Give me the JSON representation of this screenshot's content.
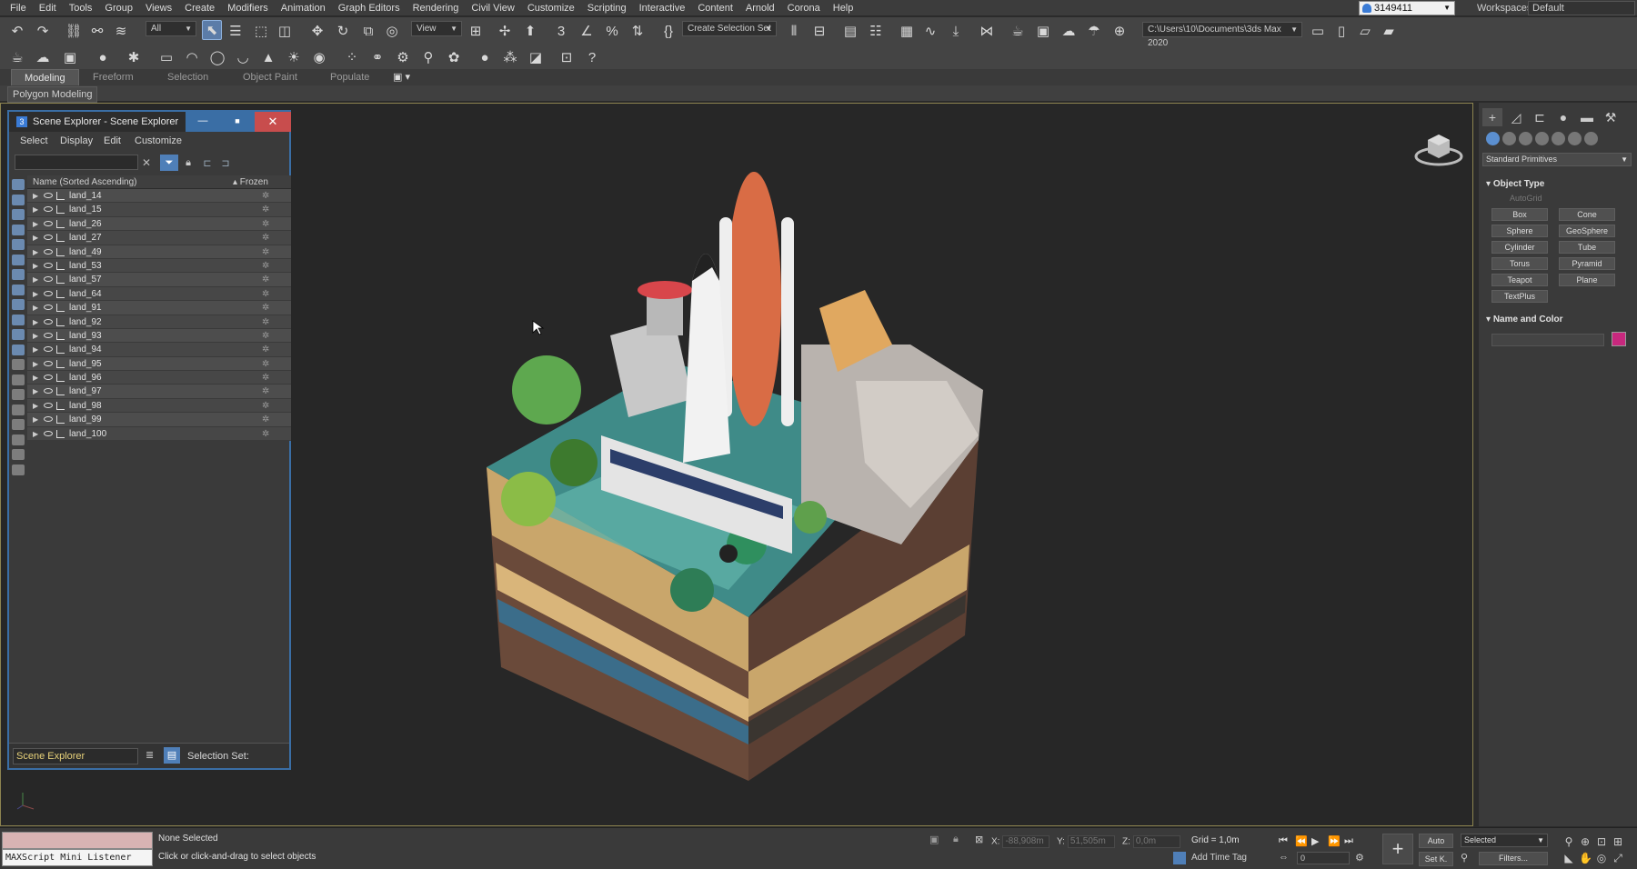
{
  "menu": [
    "File",
    "Edit",
    "Tools",
    "Group",
    "Views",
    "Create",
    "Modifiers",
    "Animation",
    "Graph Editors",
    "Rendering",
    "Civil View",
    "Customize",
    "Scripting",
    "Interactive",
    "Content",
    "Arnold",
    "Corona",
    "Help"
  ],
  "user": {
    "name": "3149411"
  },
  "workspaces": {
    "label": "Workspaces:",
    "value": "Default"
  },
  "toolbar": {
    "filter_value": "All",
    "view_value": "View",
    "selection_set": "Create Selection Set",
    "project_path": "C:\\Users\\10\\Documents\\3ds Max 2020"
  },
  "ribbon": {
    "tabs": [
      "Modeling",
      "Freeform",
      "Selection",
      "Object Paint",
      "Populate"
    ],
    "active": "Modeling",
    "sub_label": "Polygon Modeling"
  },
  "scene_explorer": {
    "title": "Scene Explorer - Scene Explorer",
    "menu": [
      "Select",
      "Display",
      "Edit",
      "Customize"
    ],
    "col_name": "Name (Sorted Ascending)",
    "col_frozen": "▴ Frozen",
    "rows": [
      "land_14",
      "land_15",
      "land_26",
      "land_27",
      "land_49",
      "land_53",
      "land_57",
      "land_64",
      "land_91",
      "land_92",
      "land_93",
      "land_94",
      "land_95",
      "land_96",
      "land_97",
      "land_98",
      "land_99",
      "land_100"
    ],
    "explorer_name": "Scene Explorer",
    "selection_set_label": "Selection Set:"
  },
  "command_panel": {
    "category": "Standard Primitives",
    "object_type_title": "Object Type",
    "autogrid": "AutoGrid",
    "buttons": [
      "Box",
      "Cone",
      "Sphere",
      "GeoSphere",
      "Cylinder",
      "Tube",
      "Torus",
      "Pyramid",
      "Teapot",
      "Plane",
      "TextPlus"
    ],
    "name_color_title": "Name and Color",
    "object_color": "#c8287e"
  },
  "status": {
    "maxscript_label": "MAXScript Mini Listener",
    "selection": "None Selected",
    "prompt": "Click or click-and-drag to select objects",
    "x_label": "X:",
    "x_value": "-88,908m",
    "y_label": "Y:",
    "y_value": "51,505m",
    "z_label": "Z:",
    "z_value": "0,0m",
    "grid": "Grid = 1,0m",
    "add_time_tag": "Add Time Tag",
    "auto_key": "Auto",
    "set_key": "Set K.",
    "key_filter": "Selected",
    "filters": "Filters...",
    "frame": "0"
  }
}
